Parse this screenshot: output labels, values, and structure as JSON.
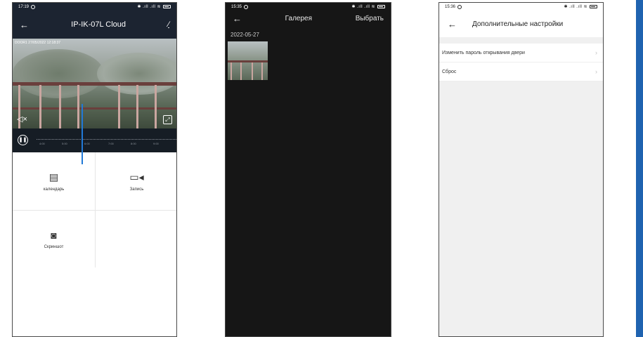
{
  "phone1": {
    "status_time": "17:19",
    "status_right": "✱ .ıll .ıll ≋",
    "title": "IP-IK-07L Cloud",
    "back_icon": "arrow-left-icon",
    "edit_icon": "pencil-icon",
    "video_osd": "DOOR1 27/05/2022 12:18:37",
    "timeline_ticks": [
      "4:00",
      "5:00",
      "6:00",
      "7:00",
      "8:00",
      "9:00"
    ],
    "actions": [
      {
        "label": "календарь",
        "icon": "calendar-icon"
      },
      {
        "label": "Запись",
        "icon": "video-record-icon"
      },
      {
        "label": "Скриншот",
        "icon": "camera-icon"
      }
    ]
  },
  "phone2": {
    "status_time": "15:35",
    "status_right": "✱ .ıll .ıll ≋",
    "title": "Галерея",
    "select_label": "Выбрать",
    "date": "2022-05-27"
  },
  "phone3": {
    "status_time": "15:36",
    "status_right": "✱ .ıll .ıll ≋",
    "title": "Дополнительные настройки",
    "items": [
      {
        "label": "Изменить пароль открывания двери"
      },
      {
        "label": "Сброс"
      }
    ]
  },
  "colors": {
    "header_dark": "#1c2431",
    "gallery_bg": "#161616",
    "settings_bg": "#f0f0f0",
    "accent_blue": "#2179d6",
    "side_bar": "#1f63b0"
  }
}
